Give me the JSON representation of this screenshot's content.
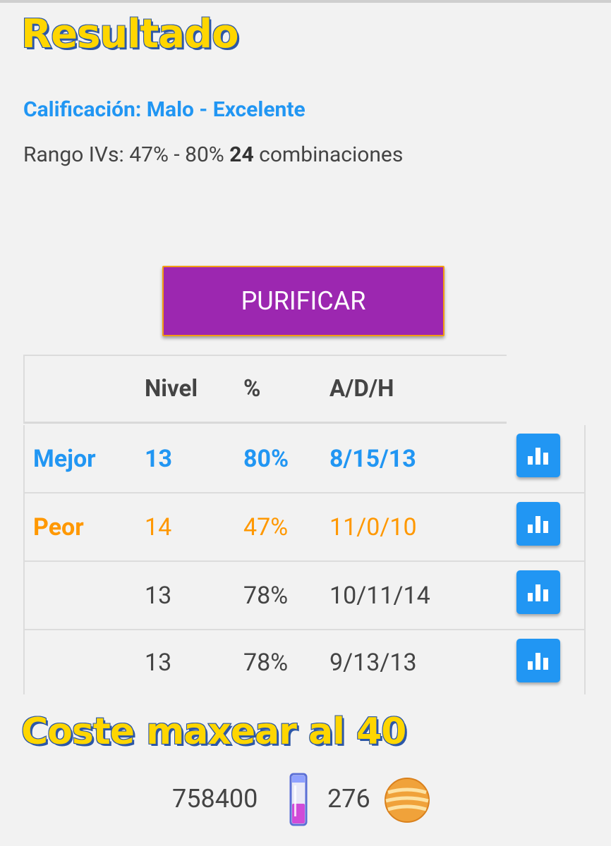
{
  "header": {
    "title": "Resultado"
  },
  "summary": {
    "rating": "Calificación: Malo - Excelente",
    "range_prefix": "Rango IVs: 47% - 80% ",
    "combinations_count": "24",
    "combinations_suffix": " combinaciones"
  },
  "purify_button": {
    "label": "PURIFICAR",
    "color": "#9c27b0"
  },
  "table": {
    "headers": [
      "",
      "Nivel",
      "%",
      "A/D/H"
    ],
    "rows": [
      {
        "label": "Mejor",
        "level": "13",
        "percent": "80%",
        "adh": "8/15/13",
        "color": "#2196f3"
      },
      {
        "label": "Peor",
        "level": "14",
        "percent": "47%",
        "adh": "11/0/10",
        "color": "#ff9800"
      },
      {
        "label": "",
        "level": "13",
        "percent": "78%",
        "adh": "10/11/14"
      },
      {
        "label": "",
        "level": "13",
        "percent": "78%",
        "adh": "9/13/13"
      }
    ],
    "row_action_icon": "bar-chart-icon"
  },
  "cost": {
    "title": "Coste maxear al 40",
    "stardust": "758400",
    "stardust_icon": "potion-icon",
    "candy": "276",
    "candy_icon": "coin-icon"
  },
  "colors": {
    "accent": "#2196f3",
    "warning": "#ff9800",
    "background": "#f2f2f2"
  }
}
